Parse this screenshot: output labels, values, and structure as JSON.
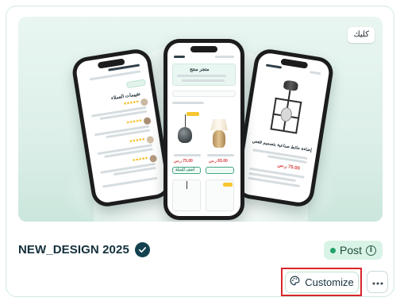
{
  "card": {
    "badge_label": "كليك",
    "title": "NEW_DESIGN 2025",
    "status": "Post",
    "customize_label": "Customize"
  },
  "preview": {
    "center_phone": {
      "header": "متجر منتج",
      "buy_button": "أضف للسلة",
      "price_1": "75.00 ر.س",
      "price_2": "65.00 ر.س"
    },
    "right_phone": {
      "product_title": "إضاءة حائط صناعية بتصميم قفص",
      "price": "75.00 ر.س"
    },
    "left_phone": {
      "section_title": "تقييمات العملاء"
    }
  },
  "colors": {
    "accent": "#13414f",
    "status_bg": "#daf3e7",
    "status_dot": "#21a36b",
    "highlight": "#d9262a"
  },
  "icons": {
    "verified": "check-badge-icon",
    "info": "info-icon",
    "customize": "palette-icon",
    "more": "ellipsis-icon"
  }
}
